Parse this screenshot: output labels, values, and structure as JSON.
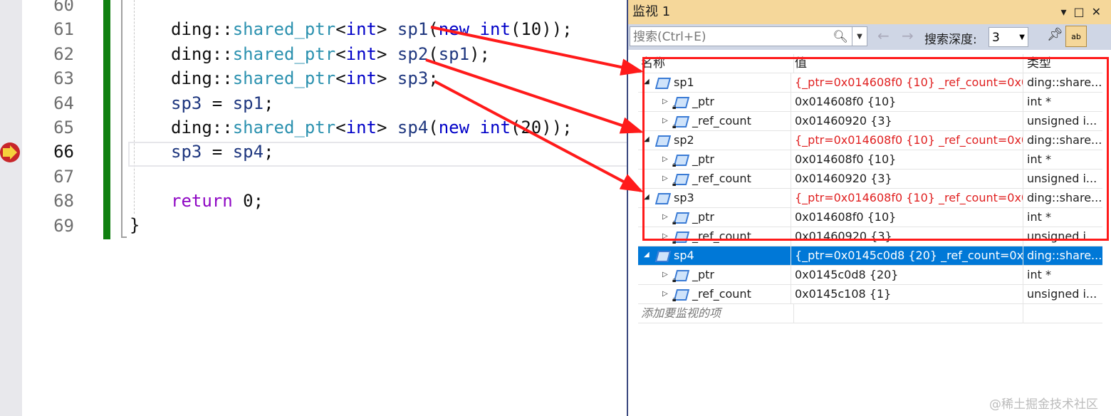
{
  "editor": {
    "line_numbers": [
      "60",
      "61",
      "62",
      "63",
      "64",
      "65",
      "66",
      "67",
      "68",
      "69"
    ],
    "current_line": "66",
    "lines": [
      [],
      [
        [
          "ding::",
          ""
        ],
        [
          "shared_ptr",
          "ty"
        ],
        [
          "<",
          ""
        ],
        [
          "int",
          "kw"
        ],
        [
          "> ",
          ""
        ],
        [
          "sp1",
          "var"
        ],
        [
          "(",
          ""
        ],
        [
          "new",
          "kw"
        ],
        [
          " ",
          ""
        ],
        [
          "int",
          "kw"
        ],
        [
          "(10));",
          ""
        ]
      ],
      [
        [
          "ding::",
          ""
        ],
        [
          "shared_ptr",
          "ty"
        ],
        [
          "<",
          ""
        ],
        [
          "int",
          "kw"
        ],
        [
          "> ",
          ""
        ],
        [
          "sp2",
          "var"
        ],
        [
          "(",
          ""
        ],
        [
          "sp1",
          "var"
        ],
        [
          ");",
          ""
        ]
      ],
      [
        [
          "ding::",
          ""
        ],
        [
          "shared_ptr",
          "ty"
        ],
        [
          "<",
          ""
        ],
        [
          "int",
          "kw"
        ],
        [
          "> ",
          ""
        ],
        [
          "sp3",
          "var"
        ],
        [
          ";",
          ""
        ]
      ],
      [
        [
          "sp3",
          "var"
        ],
        [
          " = ",
          ""
        ],
        [
          "sp1",
          "var"
        ],
        [
          ";",
          ""
        ]
      ],
      [
        [
          "ding::",
          ""
        ],
        [
          "shared_ptr",
          "ty"
        ],
        [
          "<",
          ""
        ],
        [
          "int",
          "kw"
        ],
        [
          "> ",
          ""
        ],
        [
          "sp4",
          "var"
        ],
        [
          "(",
          ""
        ],
        [
          "new",
          "kw"
        ],
        [
          " ",
          ""
        ],
        [
          "int",
          "kw"
        ],
        [
          "(20));",
          ""
        ]
      ],
      [
        [
          "sp3",
          "var"
        ],
        [
          " = ",
          ""
        ],
        [
          "sp4",
          "var"
        ],
        [
          ";",
          ""
        ]
      ],
      [],
      [
        [
          "return",
          "rt"
        ],
        [
          " 0;",
          ""
        ]
      ],
      []
    ],
    "closing_brace": "}"
  },
  "watch": {
    "title": "监视 1",
    "search_placeholder": "搜索(Ctrl+E)",
    "depth_label": "搜索深度:",
    "depth_value": "3",
    "columns": [
      "名称",
      "值",
      "类型"
    ],
    "rows": [
      {
        "level": 0,
        "name": "sp1",
        "value": "{_ptr=0x014608f0 {10} _ref_count=0x0...",
        "type": "ding::share...",
        "changed": true,
        "selected": false
      },
      {
        "level": 1,
        "name": "_ptr",
        "value": "0x014608f0 {10}",
        "type": "int *",
        "changed": false,
        "selected": false
      },
      {
        "level": 1,
        "name": "_ref_count",
        "value": "0x01460920 {3}",
        "type": "unsigned i...",
        "changed": false,
        "selected": false
      },
      {
        "level": 0,
        "name": "sp2",
        "value": "{_ptr=0x014608f0 {10} _ref_count=0x0...",
        "type": "ding::share...",
        "changed": true,
        "selected": false
      },
      {
        "level": 1,
        "name": "_ptr",
        "value": "0x014608f0 {10}",
        "type": "int *",
        "changed": false,
        "selected": false
      },
      {
        "level": 1,
        "name": "_ref_count",
        "value": "0x01460920 {3}",
        "type": "unsigned i...",
        "changed": false,
        "selected": false
      },
      {
        "level": 0,
        "name": "sp3",
        "value": "{_ptr=0x014608f0 {10} _ref_count=0x0...",
        "type": "ding::share...",
        "changed": true,
        "selected": false
      },
      {
        "level": 1,
        "name": "_ptr",
        "value": "0x014608f0 {10}",
        "type": "int *",
        "changed": false,
        "selected": false
      },
      {
        "level": 1,
        "name": "_ref_count",
        "value": "0x01460920 {3}",
        "type": "unsigned i...",
        "changed": false,
        "selected": false
      },
      {
        "level": 0,
        "name": "sp4",
        "value": "{_ptr=0x0145c0d8 {20} _ref_count=0x0...",
        "type": "ding::share...",
        "changed": false,
        "selected": true
      },
      {
        "level": 1,
        "name": "_ptr",
        "value": "0x0145c0d8 {20}",
        "type": "int *",
        "changed": false,
        "selected": false
      },
      {
        "level": 1,
        "name": "_ref_count",
        "value": "0x0145c108 {1}",
        "type": "unsigned i...",
        "changed": false,
        "selected": false
      }
    ],
    "add_item": "添加要监视的项"
  },
  "watermark": "@稀土掘金技术社区",
  "colors": {
    "accent": "#0078d7",
    "annotation": "#ff1a1a",
    "changed_value": "#e02020",
    "title_bar": "#f5d79a"
  }
}
